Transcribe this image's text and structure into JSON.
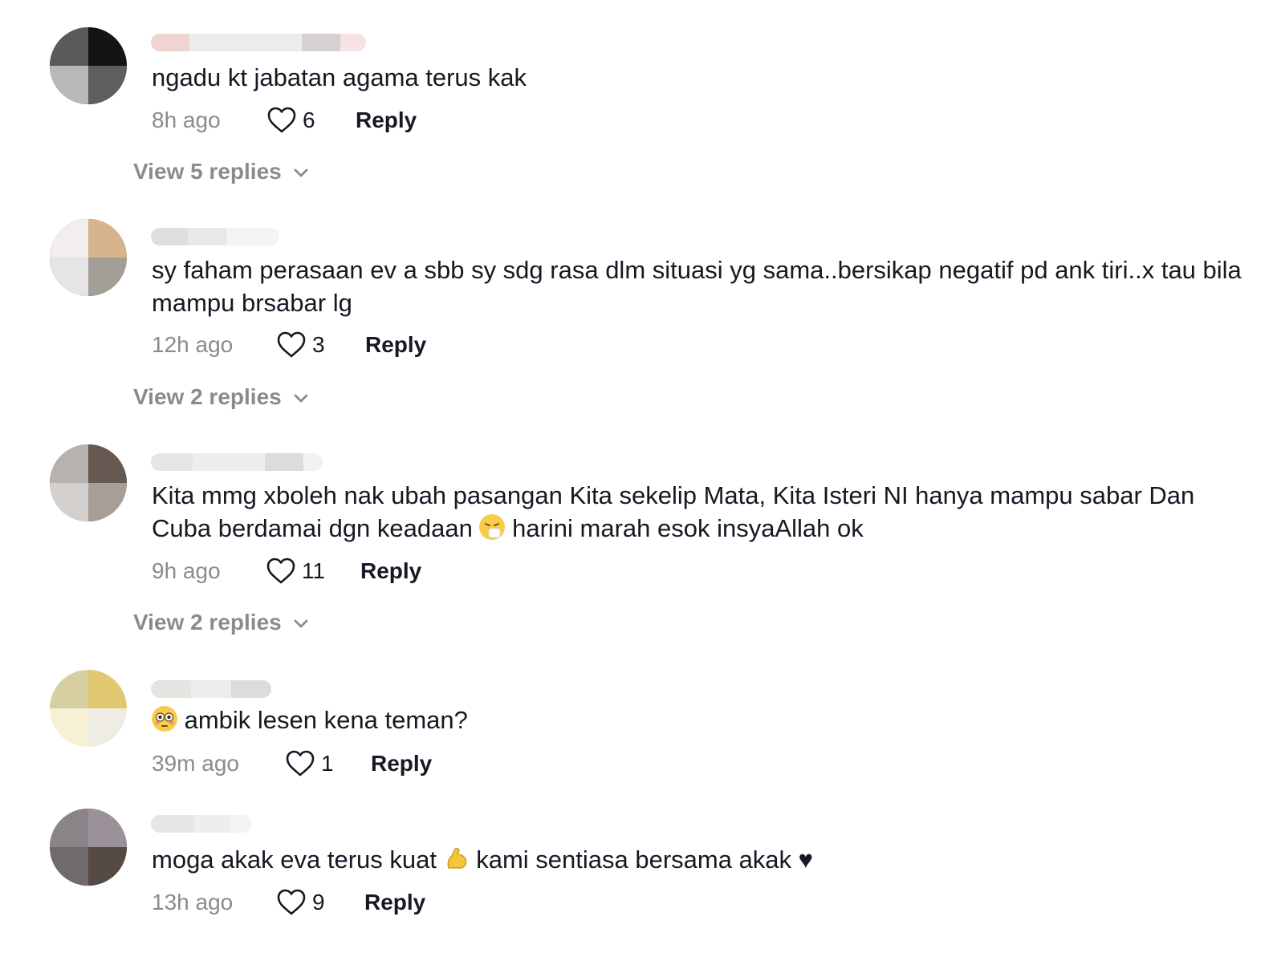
{
  "comments": [
    {
      "text": "ngadu kt jabatan agama terus kak",
      "time": "8h ago",
      "likes": "6",
      "reply_label": "Reply",
      "view_replies": "View 5 replies",
      "avatar_colors": [
        "#5a5a5a",
        "#141414",
        "#b8b8b8",
        "#5e5e5e"
      ]
    },
    {
      "text": "sy faham perasaan ev a sbb sy sdg rasa dlm situasi yg sama..bersikap negatif pd ank tiri..x tau bila mampu brsabar lg",
      "time": "12h ago",
      "likes": "3",
      "reply_label": "Reply",
      "view_replies": "View 2 replies",
      "avatar_colors": [
        "#f2eeee",
        "#d8b48c",
        "#e6e4e4",
        "#a49e98"
      ]
    },
    {
      "text_before_emoji": "Kita mmg xboleh nak ubah pasangan Kita sekelip Mata, Kita Isteri NI hanya mampu sabar Dan Cuba berdamai dgn keadaan ",
      "emoji_1": "sneezing-face",
      "text_after_emoji": " harini marah esok insyaAllah ok",
      "time": "9h ago",
      "likes": "11",
      "reply_label": "Reply",
      "view_replies": "View 2 replies",
      "avatar_colors": [
        "#b6b2b0",
        "#655952",
        "#d4d0ce",
        "#a89e98"
      ]
    },
    {
      "emoji_1": "flushed-face",
      "text_after_emoji": " ambik lesen kena teman?",
      "time": "39m ago",
      "likes": "1",
      "reply_label": "Reply",
      "avatar_colors": [
        "#d8cfa0",
        "#e0c870",
        "#f6f0d4",
        "#efece4"
      ]
    },
    {
      "text_before_emoji": "moga akak eva terus kuat ",
      "emoji_1": "flexed-biceps",
      "text_after_emoji": " kami sentiasa bersama akak ♥",
      "time": "13h ago",
      "likes": "9",
      "reply_label": "Reply",
      "avatar_colors": [
        "#8a8488",
        "#9a9298",
        "#6f6a6c",
        "#554a44"
      ]
    }
  ],
  "colors": {
    "primary_text": "#161823",
    "secondary_text": "#8a8b91"
  }
}
